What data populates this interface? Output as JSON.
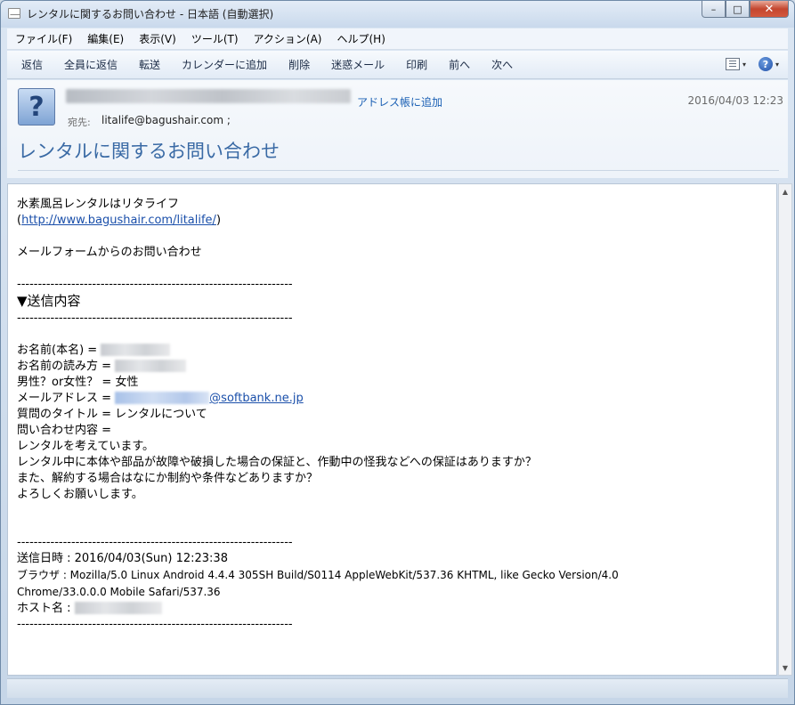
{
  "window": {
    "title": "レンタルに関するお問い合わせ - 日本語 (自動選択)",
    "controls": {
      "minimize": "–",
      "maximize": "□",
      "close": "✕"
    }
  },
  "menu": [
    "ファイル(F)",
    "編集(E)",
    "表示(V)",
    "ツール(T)",
    "アクション(A)",
    "ヘルプ(H)"
  ],
  "toolbar": [
    "返信",
    "全員に返信",
    "転送",
    "カレンダーに追加",
    "削除",
    "迷惑メール",
    "印刷",
    "前へ",
    "次へ"
  ],
  "header": {
    "avatar_glyph": "?",
    "add_to_contacts": "アドレス帳に追加",
    "date": "2016/04/03 12:23",
    "to_label": "宛先:",
    "to_value": "litalife@bagushair.com ;",
    "subject": "レンタルに関するお問い合わせ"
  },
  "body": {
    "intro_line": "水素風呂レンタルはリタライフ",
    "url_open": "(",
    "url": "http://www.bagushair.com/litalife/",
    "url_close": ")",
    "form_line": "メールフォームからのお問い合わせ",
    "separator": "------------------------------------------------------------------",
    "section_title": "▼送信内容",
    "name_label": "お名前(本名) = ",
    "reading_label": "お名前の読み方 = ",
    "gender_line": "男性？or女性？ = 女性",
    "email_label": "メールアドレス = ",
    "email_domain": "@softbank.ne.jp",
    "question_title": "質問のタイトル = レンタルについて",
    "inquiry_label": "問い合わせ内容 =",
    "inquiry_1": "レンタルを考えています。",
    "inquiry_2": "レンタル中に本体や部品が故障や破損した場合の保証と、作動中の怪我などへの保証はありますか？",
    "inquiry_3": "また、解約する場合はなにか制約や条件などありますか？",
    "inquiry_4": "よろしくお願いします。",
    "sent_date": "送信日時 : 2016/04/03(Sun) 12:23:38",
    "browser_1": "ブラウザ : Mozilla/5.0 Linux Android 4.4.4 305SH Build/S0114 AppleWebKit/537.36 KHTML, like Gecko Version/4.0",
    "browser_2": "Chrome/33.0.0.0 Mobile Safari/537.36",
    "host_label": "ホスト名 : "
  },
  "icons": {
    "print_icon": "print-icon",
    "help_icon": "?",
    "dropdown": "▾",
    "scroll_up": "▲",
    "scroll_down": "▼"
  }
}
